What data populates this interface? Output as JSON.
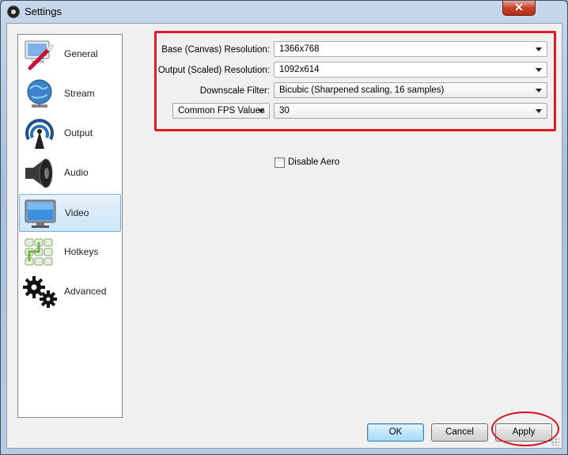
{
  "window": {
    "title": "Settings",
    "close_glyph": "✕"
  },
  "sidebar": {
    "items": [
      {
        "label": "General",
        "icon": "computer-pen-icon"
      },
      {
        "label": "Stream",
        "icon": "globe-network-icon"
      },
      {
        "label": "Output",
        "icon": "broadcast-antenna-icon"
      },
      {
        "label": "Audio",
        "icon": "speaker-icon"
      },
      {
        "label": "Video",
        "icon": "monitor-icon",
        "selected": true
      },
      {
        "label": "Hotkeys",
        "icon": "keyboard-keys-icon"
      },
      {
        "label": "Advanced",
        "icon": "gears-icon"
      }
    ]
  },
  "video": {
    "base_resolution": {
      "label": "Base (Canvas) Resolution:",
      "value": "1366x768"
    },
    "output_resolution": {
      "label": "Output (Scaled) Resolution:",
      "value": "1092x614"
    },
    "downscale_filter": {
      "label": "Downscale Filter:",
      "value": "Bicubic (Sharpened scaling, 16 samples)"
    },
    "fps_type": {
      "value": "Common FPS Values"
    },
    "fps_value": {
      "value": "30"
    },
    "disable_aero": {
      "label": "Disable Aero",
      "checked": false
    }
  },
  "buttons": {
    "ok": "OK",
    "cancel": "Cancel",
    "apply": "Apply"
  },
  "colors": {
    "annotation_red": "#e01b24",
    "selection_blue": "#cde6f7"
  }
}
